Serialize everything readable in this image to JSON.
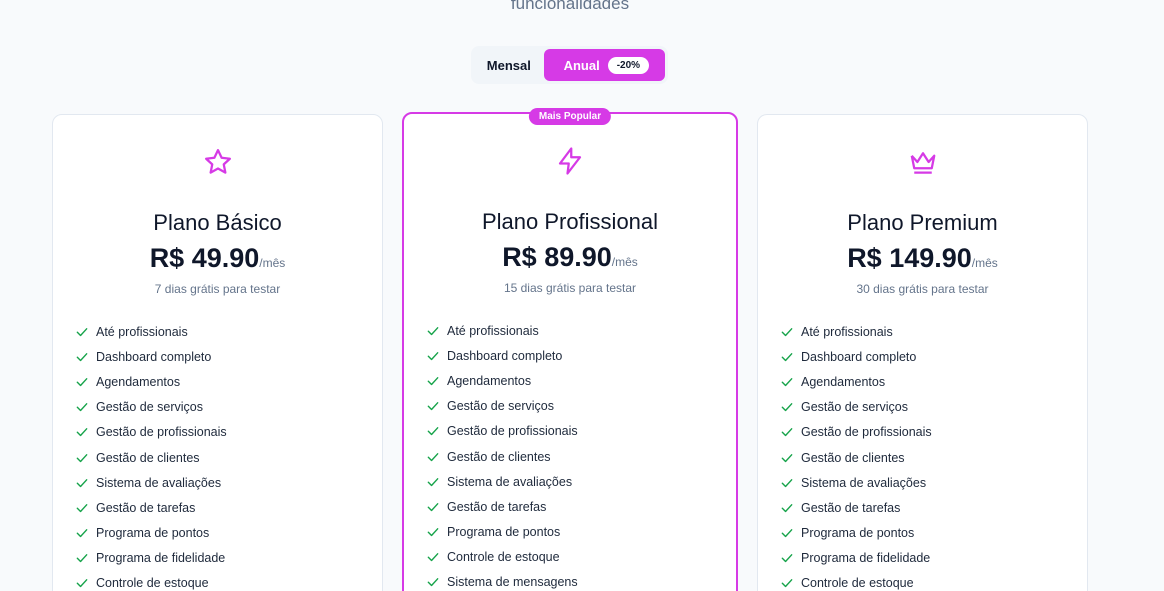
{
  "header": {
    "subtitle": "funcionalidades"
  },
  "billing_toggle": {
    "monthly_label": "Mensal",
    "annual_label": "Anual",
    "discount_badge": "-20%",
    "selected": "Anual"
  },
  "colors": {
    "accent": "#d63ae6",
    "check": "#16a34a"
  },
  "plans": [
    {
      "icon": "star-icon",
      "name": "Plano Básico",
      "price": "R$ 49.90",
      "per": "/mês",
      "trial": "7 dias grátis para testar",
      "features": [
        "Até profissionais",
        "Dashboard completo",
        "Agendamentos",
        "Gestão de serviços",
        "Gestão de profissionais",
        "Gestão de clientes",
        "Sistema de avaliações",
        "Gestão de tarefas",
        "Programa de pontos",
        "Programa de fidelidade",
        "Controle de estoque"
      ]
    },
    {
      "icon": "lightning-icon",
      "badge": "Mais Popular",
      "name": "Plano Profissional",
      "price": "R$ 89.90",
      "per": "/mês",
      "trial": "15 dias grátis para testar",
      "features": [
        "Até profissionais",
        "Dashboard completo",
        "Agendamentos",
        "Gestão de serviços",
        "Gestão de profissionais",
        "Gestão de clientes",
        "Sistema de avaliações",
        "Gestão de tarefas",
        "Programa de pontos",
        "Controle de estoque",
        "Sistema de mensagens"
      ]
    },
    {
      "icon": "crown-icon",
      "name": "Plano Premium",
      "price": "R$ 149.90",
      "per": "/mês",
      "trial": "30 dias grátis para testar",
      "features": [
        "Até profissionais",
        "Dashboard completo",
        "Agendamentos",
        "Gestão de serviços",
        "Gestão de profissionais",
        "Gestão de clientes",
        "Sistema de avaliações",
        "Gestão de tarefas",
        "Programa de pontos",
        "Programa de fidelidade",
        "Controle de estoque"
      ]
    }
  ]
}
